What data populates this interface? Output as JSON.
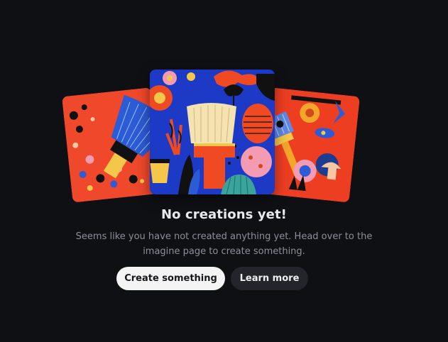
{
  "empty_state": {
    "title": "No creations yet!",
    "description_line1": "Seems like you have not created anything yet. Head over to the",
    "description_line2": "imagine page to create something.",
    "primary_button": "Create something",
    "secondary_button": "Learn more"
  },
  "colors": {
    "background": "#0f1014",
    "title": "#e9e9ec",
    "description": "#8c8f98",
    "primary_button_bg": "#f4f4f5",
    "primary_button_text": "#16171b",
    "secondary_button_bg": "#23252b",
    "secondary_button_text": "#eeeef0"
  }
}
